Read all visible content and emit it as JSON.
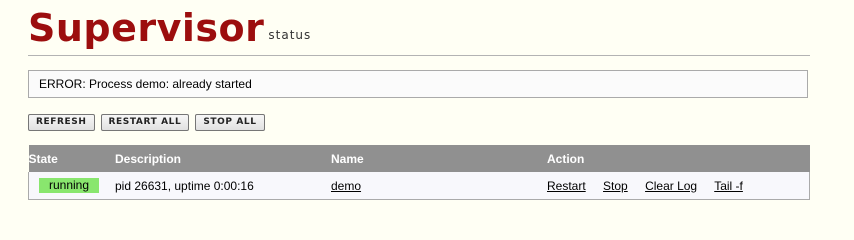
{
  "header": {
    "logo": "Supervisor",
    "subtitle": "status"
  },
  "message": "ERROR: Process demo: already started",
  "toolbar": {
    "refresh": "REFRESH",
    "restart_all": "RESTART ALL",
    "stop_all": "STOP ALL"
  },
  "table": {
    "headers": {
      "state": "State",
      "description": "Description",
      "name": "Name",
      "action": "Action"
    },
    "rows": [
      {
        "state": "running",
        "description": "pid 26631, uptime 0:00:16",
        "name": "demo",
        "actions": {
          "restart": "Restart",
          "stop": "Stop",
          "clear_log": "Clear Log",
          "tail": "Tail -f"
        }
      }
    ]
  },
  "colors": {
    "logo": "#9c0e0e",
    "running": "#89e66e",
    "table_header": "#909090"
  }
}
